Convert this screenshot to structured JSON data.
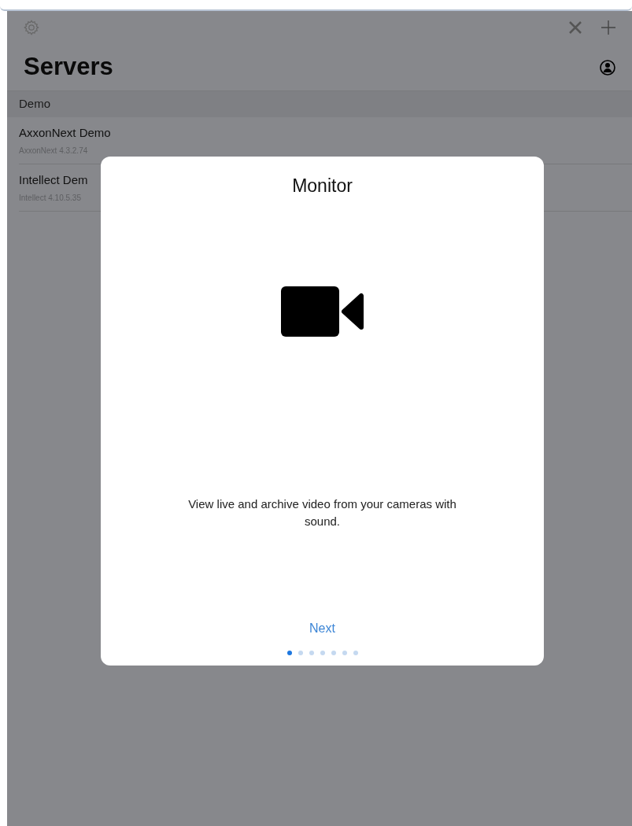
{
  "navigation": {
    "title": "Servers"
  },
  "sections": [
    {
      "header": "Demo",
      "rows": [
        {
          "title": "AxxonNext Demo",
          "subtitle": "AxxonNext 4.3.2.74"
        },
        {
          "title": "Intellect Dem",
          "subtitle": "Intellect 4.10.5.35"
        }
      ]
    }
  ],
  "dialog": {
    "title": "Monitor",
    "description": "View live and archive video from your cameras with sound.",
    "button": "Next",
    "page_dots": [
      {
        "selected": true
      },
      {
        "selected": false
      },
      {
        "selected": false
      },
      {
        "selected": false
      },
      {
        "selected": false
      },
      {
        "selected": false
      },
      {
        "selected": false
      }
    ]
  }
}
